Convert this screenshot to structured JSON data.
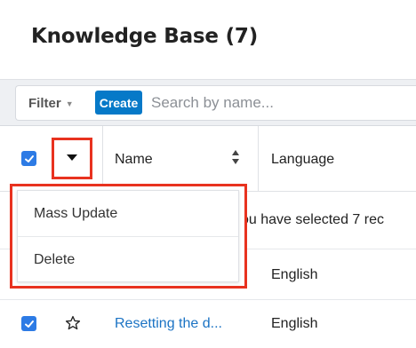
{
  "header": {
    "title": "Knowledge Base (7)"
  },
  "toolbar": {
    "filter_label": "Filter",
    "create_label": "Create",
    "search_placeholder": "Search by name..."
  },
  "columns": {
    "name": "Name",
    "language": "Language"
  },
  "mass_menu": {
    "items": [
      {
        "label": "Mass Update"
      },
      {
        "label": "Delete"
      }
    ]
  },
  "rows": [
    {
      "notice": "ou have selected 7 rec"
    },
    {
      "name": ".",
      "language": "English"
    },
    {
      "name": "Resetting the d...",
      "language": "English",
      "checked": true,
      "favorite": false
    }
  ],
  "colors": {
    "accent": "#0679c8",
    "checkbox": "#2d7be5",
    "highlight": "#e8321f",
    "link": "#1b73c4"
  }
}
